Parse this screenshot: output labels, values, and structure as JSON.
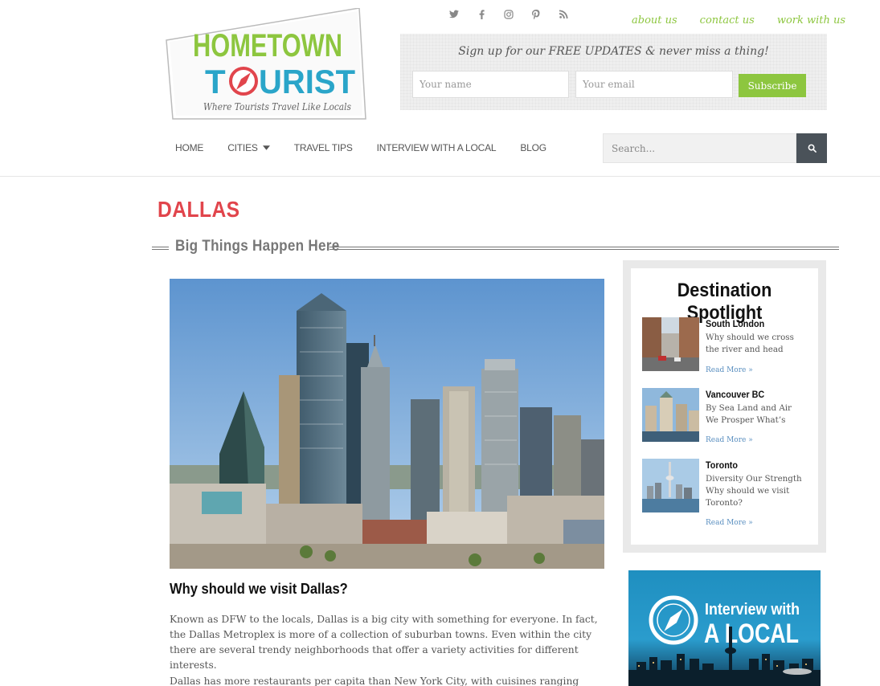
{
  "brand": {
    "logo_line1": "HOMETOWN",
    "logo_line2_a": "T",
    "logo_line2_b": "URIST",
    "logo_tagline": "Where Tourists Travel Like Locals"
  },
  "social": [
    {
      "icon": "twitter-icon",
      "glyph": "🐦"
    },
    {
      "icon": "facebook-icon",
      "glyph": "f"
    },
    {
      "icon": "instagram-icon",
      "glyph": "◎"
    },
    {
      "icon": "pinterest-icon",
      "glyph": "P"
    },
    {
      "icon": "rss-icon",
      "glyph": ")"
    }
  ],
  "toplinks": {
    "about": "about us",
    "contact": "contact us",
    "work": "work with us"
  },
  "signup": {
    "message": "Sign up for our FREE UPDATES & never miss a thing!",
    "name_placeholder": "Your name",
    "email_placeholder": "Your email",
    "button": "Subscribe"
  },
  "nav": {
    "home": "HOME",
    "cities": "CITIES",
    "travel_tips": "TRAVEL TIPS",
    "interview": "INTERVIEW WITH A LOCAL",
    "blog": "BLOG"
  },
  "search": {
    "placeholder": "Search..."
  },
  "page": {
    "title": "DALLAS",
    "tagline": "Big Things Happen Here"
  },
  "article": {
    "heading": "Why should we visit Dallas?",
    "p1": "Known as DFW to the locals, Dallas is a big city with something for everyone. In fact, the Dallas Metroplex is more of a collection of suburban towns. Even within the city there are several trendy neighborhoods that offer a variety activities for different interests.",
    "p2": "Dallas has more restaurants per capita than New York City, with cuisines ranging from"
  },
  "sidebar": {
    "title": "Destination Spotlight",
    "cards": [
      {
        "title": "South London",
        "excerpt": "Why should we cross the river and head",
        "more": "Read More »"
      },
      {
        "title": "Vancouver BC",
        "excerpt": "By Sea Land and Air We Prosper What’s",
        "more": "Read More »"
      },
      {
        "title": "Toronto",
        "excerpt": "Diversity Our Strength Why should we visit Toronto?",
        "more": "Read More »"
      }
    ],
    "banner_line1": "Interview with",
    "banner_line2": "A LOCAL"
  },
  "colors": {
    "accent_green": "#8dc63f",
    "title_red": "#e1454c",
    "logo_blue": "#2aa5c9",
    "search_button": "#4a5259"
  }
}
